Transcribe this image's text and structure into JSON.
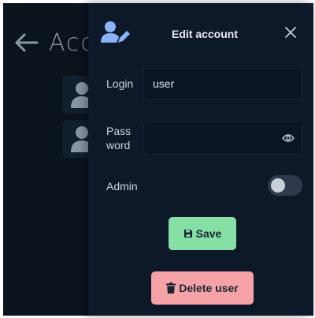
{
  "background": {
    "title": "Acc",
    "accounts": [
      {
        "avatar_icon": "user-icon"
      },
      {
        "avatar_icon": "user-icon"
      }
    ]
  },
  "drawer": {
    "header_icon": "user-edit-icon",
    "title": "Edit account",
    "close_icon": "close-icon"
  },
  "form": {
    "login_label": "Login",
    "login_value": "user",
    "password_label_line1": "Pass",
    "password_label_line2": "word",
    "password_value": "",
    "password_icon": "eye-icon",
    "admin_label": "Admin",
    "admin_enabled": false
  },
  "actions": {
    "save_label": "Save",
    "save_icon": "floppy-disk-icon",
    "delete_label": "Delete user",
    "delete_icon": "trash-icon"
  },
  "colors": {
    "drawer_bg": "#0d1828",
    "accent": "#8ab4f8",
    "save": "#86e0a6",
    "delete": "#f5a3a6"
  }
}
